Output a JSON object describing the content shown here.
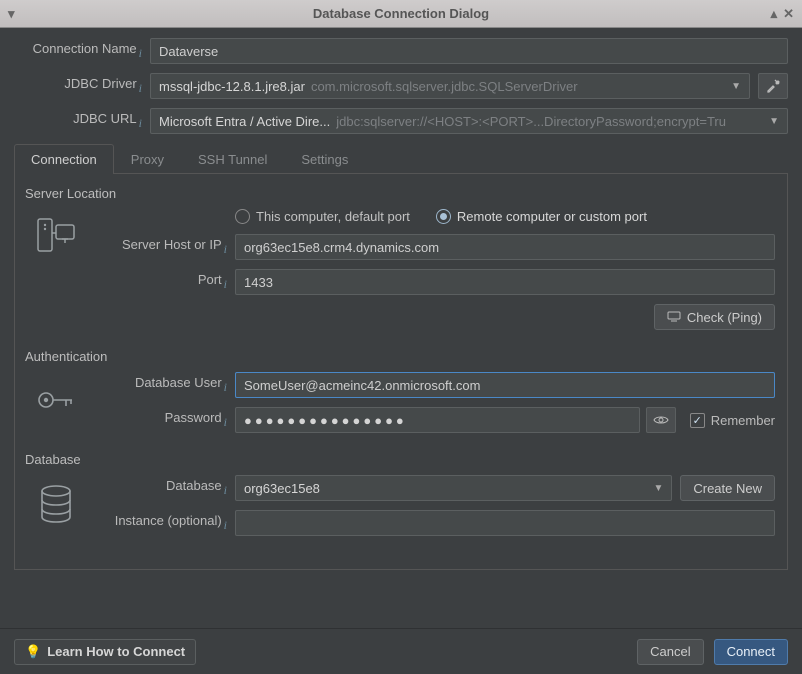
{
  "window": {
    "title": "Database Connection Dialog"
  },
  "top": {
    "conn_name_label": "Connection Name",
    "conn_name_value": "Dataverse",
    "jdbc_driver_label": "JDBC Driver",
    "jdbc_driver_value": "mssql-jdbc-12.8.1.jre8.jar",
    "jdbc_driver_hint": "com.microsoft.sqlserver.jdbc.SQLServerDriver",
    "jdbc_url_label": "JDBC URL",
    "jdbc_url_value": "Microsoft Entra / Active Dire...",
    "jdbc_url_hint": "jdbc:sqlserver://<HOST>:<PORT>...DirectoryPassword;encrypt=Tru"
  },
  "tabs": {
    "connection": "Connection",
    "proxy": "Proxy",
    "ssh": "SSH Tunnel",
    "settings": "Settings"
  },
  "server": {
    "section": "Server Location",
    "radio_local": "This computer, default port",
    "radio_remote": "Remote computer or custom port",
    "host_label": "Server Host or IP",
    "host_value": "org63ec15e8.crm4.dynamics.com",
    "port_label": "Port",
    "port_value": "1433",
    "check_btn": "Check (Ping)"
  },
  "auth": {
    "section": "Authentication",
    "user_label": "Database User",
    "user_value": "SomeUser@acmeinc42.onmicrosoft.com",
    "pass_label": "Password",
    "pass_mask": "●●●●●●●●●●●●●●●",
    "remember": "Remember"
  },
  "db": {
    "section": "Database",
    "db_label": "Database",
    "db_value": "org63ec15e8",
    "instance_label": "Instance (optional)",
    "instance_value": "",
    "create_new": "Create New"
  },
  "footer": {
    "learn": "Learn How to Connect",
    "cancel": "Cancel",
    "connect": "Connect"
  }
}
